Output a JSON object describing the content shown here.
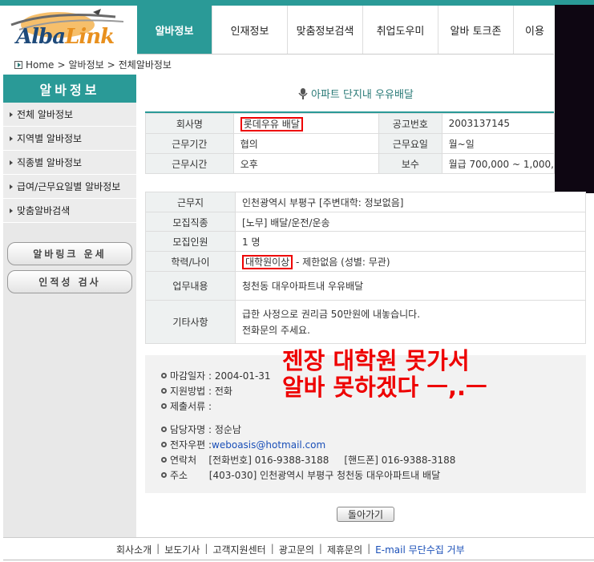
{
  "logo": {
    "text_a": "Alba",
    "text_b": "Link"
  },
  "nav": {
    "tabs": [
      {
        "label": "알바정보",
        "active": true
      },
      {
        "label": "인재정보",
        "active": false
      },
      {
        "label": "맞춤정보검색",
        "active": false
      },
      {
        "label": "취업도우미",
        "active": false
      },
      {
        "label": "알바 토크존",
        "active": false
      },
      {
        "label": "이용",
        "active": false
      }
    ]
  },
  "breadcrumb": {
    "home": "Home",
    "sep": ">",
    "level1": "알바정보",
    "level2": "전체알바정보"
  },
  "sidebar": {
    "title": "알바정보",
    "items": [
      {
        "label": "전체 알바정보"
      },
      {
        "label": "지역별 알바정보"
      },
      {
        "label": "직종별 알바정보"
      },
      {
        "label": "급여/근무요일별 알바정보"
      },
      {
        "label": "맞춤알바검색"
      }
    ],
    "buttons": [
      {
        "label": "알바링크 운세"
      },
      {
        "label": "인적성 검사"
      }
    ]
  },
  "job": {
    "title": "아파트 단지내 우유배달",
    "company_label": "회사명",
    "company": "롯데우유 배달",
    "notice_label": "공고번호",
    "notice_no": "2003137145",
    "period_label": "근무기간",
    "period": "협의",
    "days_label": "근무요일",
    "days": "월~일",
    "time_label": "근무시간",
    "time": "오후",
    "pay_label": "보수",
    "pay": "월급 700,000 ~ 1,000,",
    "location_label": "근무지",
    "location": "인천광역시 부평구 [주변대학: 정보없음]",
    "category_label": "모집직종",
    "category": "[노무] 배달/운전/운송",
    "count_label": "모집인원",
    "count": "1 명",
    "edu_label": "학력/나이",
    "edu": "대학원이상",
    "edu_rest": " - 제한없음 (성별: 무관)",
    "duty_label": "업무내용",
    "duty": "청천동 대우아파트내 우유배달",
    "etc_label": "기타사항",
    "etc_line1": "급한 사정으로 권리금 50만원에 내놓습니다.",
    "etc_line2": "전화문의 주세요."
  },
  "info": {
    "deadline": "마감일자 : 2004-01-31",
    "method": "지원방법 : 전화",
    "docs": "제출서류 :",
    "manager": "담당자명 : 정순남",
    "email_label": "전자우편 : ",
    "email": "weboasis@hotmail.com",
    "contact": "연락처    [전화번호] 016-9388-3188     [핸드폰] 016-9388-3188",
    "address": "주소       [403-030] 인천광역시 부평구 청천동 대우아파트내 배달"
  },
  "annotation": {
    "line1": "젠장 대학원 못가서",
    "line2": "알바 못하겠다 ㅡ,.ㅡ"
  },
  "back_button": "돌아가기",
  "footer": {
    "links": [
      "회사소개",
      "보도기사",
      "고객지원센터",
      "광고문의",
      "제휴문의"
    ],
    "email_link": "E-mail 무단수집 거부"
  },
  "colors": {
    "teal": "#2a9a97",
    "annotation": "#e00000",
    "link": "#1a4fb8"
  }
}
